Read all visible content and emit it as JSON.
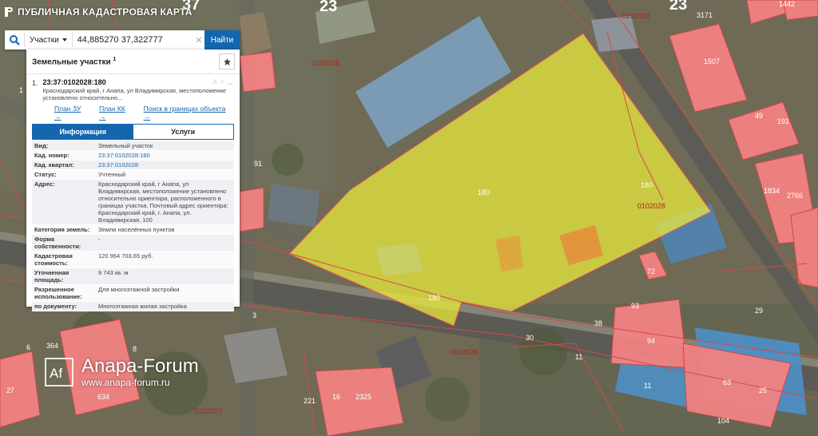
{
  "app": {
    "title": "ПУБЛИЧНАЯ КАДАСТРОВАЯ КАРТА"
  },
  "search": {
    "type_label": "Участки",
    "value": "44,885270 37,322777",
    "button_label": "Найти",
    "clear": "✕"
  },
  "panel": {
    "title": "Земельные участки",
    "count": "1",
    "result": {
      "index": "1.",
      "number": "23:37:0102028:180",
      "address": "Краснодарский край, г Анапа, ул Владимирская, местоположение установлено относительно...",
      "links": [
        "План ЗУ →",
        "План КК →",
        "Поиск в границах объекта →"
      ]
    },
    "tabs": [
      "Информация",
      "Услуги"
    ],
    "attributes": [
      {
        "k": "Вид:",
        "v": "Земельный участок"
      },
      {
        "k": "Кад. номер:",
        "v": "23:37:0102028:180",
        "link": true
      },
      {
        "k": "Кад. квартал:",
        "v": "23:37:0102028",
        "link": true
      },
      {
        "k": "Статус:",
        "v": "Учтенный"
      },
      {
        "k": "Адрес:",
        "v": "Краснодарский край, г Анапа, ул Владимирская, местоположение установлено относительно ориентира, расположенного в границах участка. Почтовый адрес ориентира: Краснодарский край, г. Анапа, ул. Владимирская, 100"
      },
      {
        "k": "Категория земель:",
        "v": "Земли населённых пунктов"
      },
      {
        "k": "Форма собственности:",
        "v": "-"
      },
      {
        "k": "Кадастровая стоимость:",
        "v": "120 964 703,65 руб."
      },
      {
        "k": "Уточненная площадь:",
        "v": "9 743 кв. м"
      },
      {
        "k": "Разрешенное использование:",
        "v": "Для многоэтажной застройки"
      },
      {
        "k": "по документу:",
        "v": "Многоэтажная жилая застройка"
      }
    ]
  },
  "map": {
    "labels": {
      "q_top": "0102028",
      "q_right": "0102028",
      "q_bottom": "0102028",
      "q_bl": "0102027",
      "q_tr": "0102029",
      "n23a": "23",
      "n23b": "23",
      "n37": "37",
      "l180a": "180",
      "l180b": "180",
      "l180c": "180",
      "l91": "91",
      "l49": "49",
      "l191": "191",
      "l1834": "1834",
      "l2766": "2766",
      "l1507": "1507",
      "l3171": "3171",
      "l1442": "1442",
      "l93": "93",
      "l94": "94",
      "l63": "63",
      "l25": "25",
      "l16": "16",
      "l2325": "2325",
      "l221": "221",
      "l30": "30",
      "l11a": "11",
      "l11b": "11",
      "l29": "29",
      "l104": "104",
      "l6": "6",
      "l364": "364",
      "l8": "8",
      "l634": "634",
      "l57": "57",
      "l27": "27",
      "l38": "38",
      "l1": "1",
      "l3": "3",
      "l72": "72"
    }
  },
  "watermark": {
    "main": "Anapa-Forum",
    "sub": "www.anapa-forum.ru",
    "logo": "Af"
  },
  "colors": {
    "accent": "#1466b0",
    "parcel": "#f27a7a",
    "selected": "#eaea3c"
  }
}
